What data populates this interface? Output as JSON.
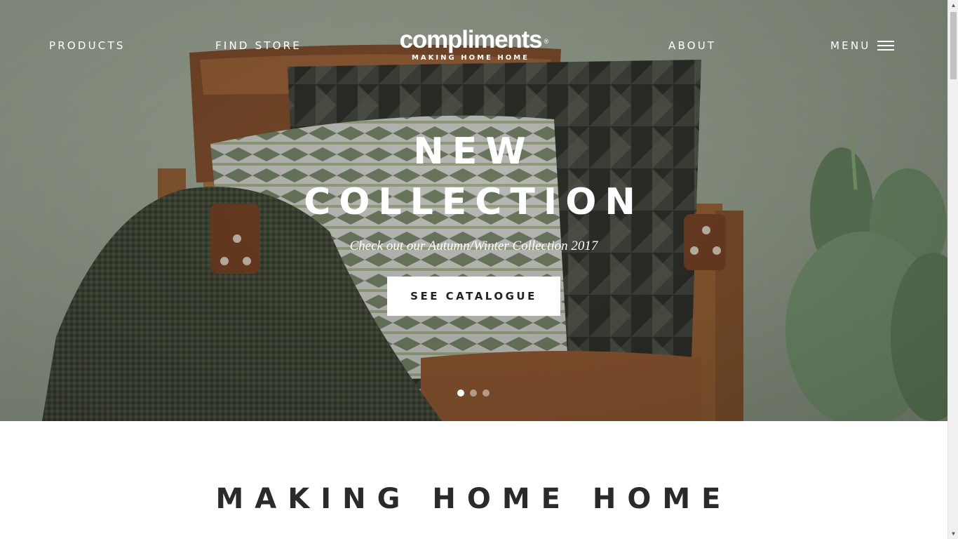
{
  "nav": {
    "products": "PRODUCTS",
    "find_store": "FIND STORE",
    "about": "ABOUT",
    "menu": "MENU"
  },
  "logo": {
    "word": "compliments",
    "registered": "®",
    "tagline": "MAKING HOME HOME"
  },
  "hero": {
    "title_line1": "NEW",
    "title_line2": "COLLECTION",
    "subtitle": "Check out our Autumn/Winter Collection 2017",
    "cta_label": "SEE CATALOGUE",
    "slides_total": 3,
    "active_slide": 1
  },
  "section": {
    "title": "MAKING HOME HOME"
  },
  "icons": {
    "menu": "hamburger-icon",
    "scroll_up": "arrow-up-icon",
    "scroll_down": "arrow-down-icon"
  },
  "colors": {
    "hero_wall": "#9aa493",
    "cta_background": "#ffffff",
    "section_text": "#2a2a2a"
  }
}
